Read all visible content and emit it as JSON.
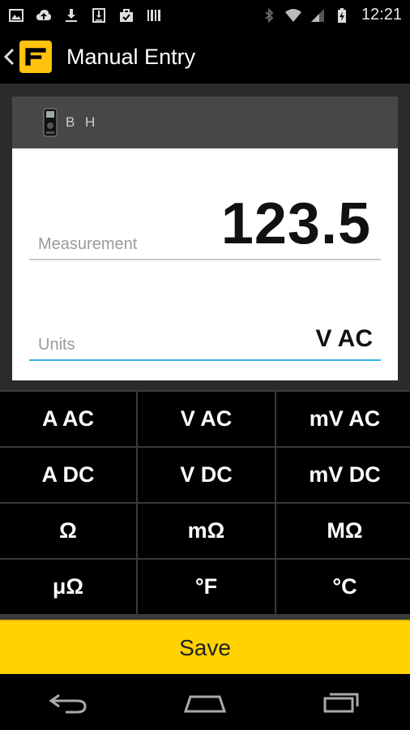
{
  "status_bar": {
    "icons_left": [
      "image-icon",
      "cloud-upload-icon",
      "download-icon",
      "download-box-icon",
      "briefcase-check-icon",
      "barcode-icon"
    ],
    "icons_right": [
      "bluetooth-icon",
      "wifi-icon",
      "signal-icon",
      "battery-charging-icon"
    ],
    "time": "12:21"
  },
  "action_bar": {
    "logo_letter": "F",
    "title": "Manual Entry",
    "accent_color": "#ffc20e"
  },
  "card": {
    "device_name": "B H",
    "measurement": {
      "label": "Measurement",
      "value": "123.5"
    },
    "units": {
      "label": "Units",
      "value": "V AC",
      "focus_color": "#33b5e5"
    }
  },
  "keypad": {
    "keys": [
      "A AC",
      "V AC",
      "mV AC",
      "A DC",
      "V DC",
      "mV DC",
      "Ω",
      "mΩ",
      "MΩ",
      "μΩ",
      "°F",
      "°C"
    ]
  },
  "save": {
    "label": "Save",
    "color": "#ffd200"
  },
  "nav_bar": {
    "icons": [
      "back-icon",
      "home-icon",
      "recent-apps-icon"
    ]
  }
}
